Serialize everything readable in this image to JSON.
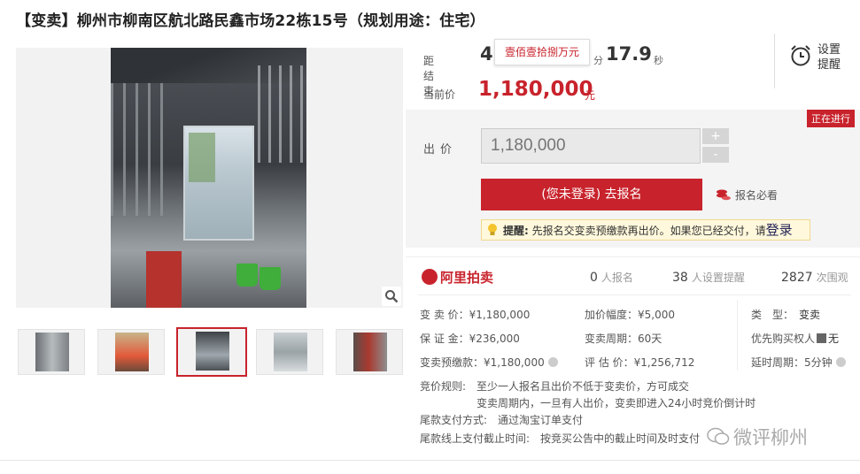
{
  "title": "【变卖】柳州市柳南区航北路民鑫市场22栋15号（规划用途：住宅）",
  "countdown": {
    "label": "距结束",
    "value_partial": "4",
    "unit_min": "分",
    "seconds": "17.9",
    "unit_sec": "秒",
    "tooltip": "壹佰壹拾捌万元"
  },
  "remind": {
    "label_line1": "设置",
    "label_line2": "提醒"
  },
  "current_price": {
    "label": "当前价",
    "value": "1,180,000",
    "unit": "元"
  },
  "status_badge": "正在进行",
  "bid": {
    "label": "出价",
    "input_placeholder": "1,180,000",
    "plus": "+",
    "minus": "-",
    "register_button": "(您未登录) 去报名",
    "must_read": "报名必看",
    "notice_prefix": "提醒:",
    "notice_text": "先报名交变卖预缴款再出价。如果您已经交付，请",
    "notice_link": "登录"
  },
  "brand": "阿里拍卖",
  "stats": [
    {
      "count": "0",
      "label": "人报名"
    },
    {
      "count": "38",
      "label": "人设置提醒"
    },
    {
      "count": "2827",
      "label": "次围观"
    }
  ],
  "details": {
    "sale_price": "变 卖 价：¥1,180,000",
    "increment": "加价幅度：¥5,000",
    "type_label": "类　型：",
    "type_value": "变卖",
    "deposit": "保 证 金：¥236,000",
    "period": "变卖周期：60天",
    "priority_label": "优先购买权人",
    "priority_value": "无",
    "prepay": "变卖预缴款：¥1,180,000",
    "appraisal": "评 估 价：¥1,256,712",
    "delay": "延时周期：5分钟"
  },
  "rules": {
    "line1": "竞价规则:　至少一人报名且出价不低于变卖价，方可成交",
    "line2": "变卖周期内，一旦有人出价，变卖即进入24小时竞价倒计时",
    "line3": "尾款支付方式:　通过淘宝订单支付",
    "line4": "尾款线上支付截止时间:　按竞买公告中的截止时间及时支付"
  },
  "watermark": "微评柳州",
  "thumbnail_count": 5
}
